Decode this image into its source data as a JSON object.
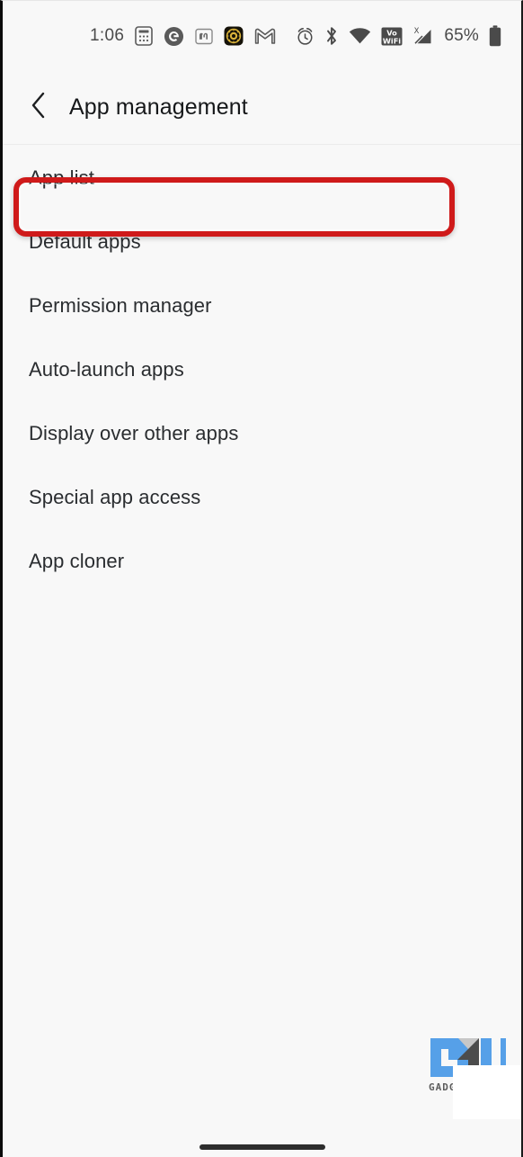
{
  "status_bar": {
    "clock": "1:06",
    "battery_percent": "65%",
    "left_icons": [
      {
        "name": "calculator-icon",
        "glyph": "calculator"
      },
      {
        "name": "google-icon",
        "glyph": "G"
      },
      {
        "name": "mastodon-icon",
        "glyph": "m"
      },
      {
        "name": "app-badge-icon",
        "glyph": "circle"
      },
      {
        "name": "gmail-icon",
        "glyph": "M"
      }
    ],
    "right_icons": [
      {
        "name": "alarm-icon"
      },
      {
        "name": "bluetooth-icon"
      },
      {
        "name": "wifi-icon"
      },
      {
        "name": "volte-wifi-icon",
        "label_top": "Vo",
        "label_bottom": "WiFi"
      },
      {
        "name": "cellular-signal-icon",
        "label": "X"
      },
      {
        "name": "battery-icon"
      }
    ]
  },
  "header": {
    "back_label": "Back",
    "title": "App management"
  },
  "list": {
    "items": [
      {
        "label": "App list",
        "highlighted": true
      },
      {
        "label": "Default apps",
        "highlighted": false
      },
      {
        "label": "Permission manager",
        "highlighted": false
      },
      {
        "label": "Auto-launch apps",
        "highlighted": false
      },
      {
        "label": "Display over other apps",
        "highlighted": false
      },
      {
        "label": "Special app access",
        "highlighted": false
      },
      {
        "label": "App cloner",
        "highlighted": false
      }
    ]
  },
  "annotation": {
    "highlight_color": "#cf1a1a",
    "target_label": "App list"
  },
  "watermark": {
    "logo_text": "GU",
    "caption": "GADG"
  },
  "colors": {
    "background": "#f8f8f8",
    "text_primary": "#2a2d30",
    "title": "#16181a",
    "status_icon": "#4a4a4a",
    "accent_red": "#cf1a1a",
    "logo_blue": "#56a0e8",
    "logo_dark": "#4c4c4c"
  },
  "nav": {
    "gesture_bar": "home-gesture-bar"
  }
}
